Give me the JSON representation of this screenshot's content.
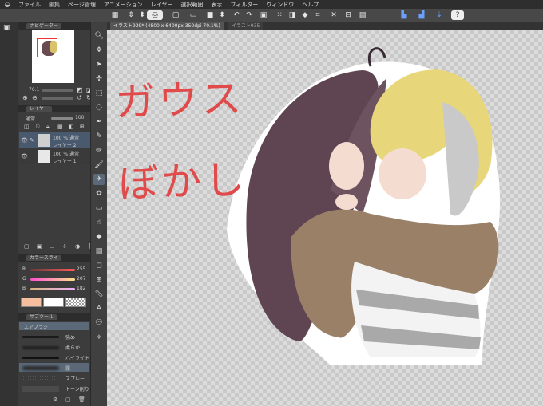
{
  "menu": [
    "ファイル",
    "編集",
    "ページ管理",
    "アニメーション",
    "レイヤー",
    "選択範囲",
    "表示",
    "フィルター",
    "ウィンドウ",
    "ヘルプ"
  ],
  "panels": {
    "navigator": {
      "title": "ナビゲーター",
      "zoom": "70.1"
    },
    "layer": {
      "title": "レイヤー",
      "blend_mode": "通常",
      "opacity": "100",
      "layers": [
        {
          "opacity_mode": "100 % 通常",
          "name": "レイヤー 2"
        },
        {
          "opacity_mode": "100 % 通常",
          "name": "レイヤー 1"
        }
      ]
    },
    "color": {
      "title": "カラースライ",
      "channels": [
        {
          "label": "R",
          "value": "255"
        },
        {
          "label": "G",
          "value": "207"
        },
        {
          "label": "B",
          "value": "182"
        }
      ],
      "main_color": "#F5BE9E",
      "sub_color": "#FFFFFF"
    },
    "subtool": {
      "title": "サブツール",
      "group": "エアブラシ",
      "items": [
        "強め",
        "柔らか",
        "ハイライト",
        "霧",
        "スプレー",
        "トーン削り"
      ]
    }
  },
  "canvas": {
    "tabs": [
      "イラスト939* (4800 x 6400px 350dpi 70.1%)",
      "イラスト935"
    ],
    "handwritten": [
      "ガウス",
      "ぼかし"
    ]
  }
}
